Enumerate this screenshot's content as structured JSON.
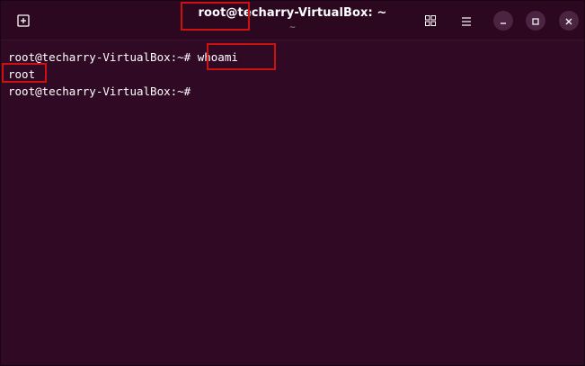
{
  "window": {
    "title": "root@techarry-VirtualBox: ~",
    "subtitle": "~"
  },
  "icons": {
    "new_tab": "new-tab-icon",
    "grid": "grid-icon",
    "menu": "hamburger-menu-icon",
    "minimize": "minimize-icon",
    "maximize": "maximize-icon",
    "close": "close-icon"
  },
  "terminal": {
    "lines": [
      "root@techarry-VirtualBox:~# whoami",
      "root",
      "root@techarry-VirtualBox:~#"
    ]
  },
  "colors": {
    "terminal_bg": "#300a24",
    "titlebar_bg": "#2b0820",
    "highlight": "#cc1111"
  }
}
